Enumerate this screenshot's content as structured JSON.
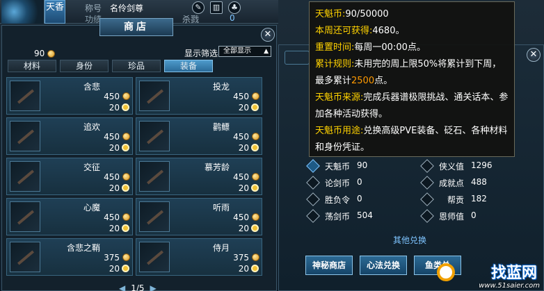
{
  "character": {
    "badge": "天香",
    "title_label": "称号",
    "title_value": "名伶剑尊",
    "kill_label": "杀戮",
    "kill_value": "0",
    "faded_label": "功绩"
  },
  "shop": {
    "title": "商店",
    "coins": "90",
    "filter_label": "显示筛选",
    "filter_value": "全部显示",
    "tabs": [
      {
        "label": "材料"
      },
      {
        "label": "身份"
      },
      {
        "label": "珍品"
      },
      {
        "label": "装备",
        "active": true
      }
    ],
    "items": [
      {
        "name": "含悲",
        "price": "450",
        "points": "20"
      },
      {
        "name": "投龙",
        "price": "450",
        "points": "20"
      },
      {
        "name": "追欢",
        "price": "450",
        "points": "20"
      },
      {
        "name": "鹳鳔",
        "price": "450",
        "points": "20"
      },
      {
        "name": "交征",
        "price": "450",
        "points": "20"
      },
      {
        "name": "慕芳龄",
        "price": "450",
        "points": "20"
      },
      {
        "name": "心魔",
        "price": "450",
        "points": "20"
      },
      {
        "name": "听雨",
        "price": "450",
        "points": "20"
      },
      {
        "name": "含悲之鞘",
        "price": "375",
        "points": "20"
      },
      {
        "name": "侍月",
        "price": "375",
        "points": "20"
      }
    ],
    "page": "1/5"
  },
  "stats": [
    {
      "label": "天魁币",
      "value": "90"
    },
    {
      "label": "侠义值",
      "value": "1296"
    },
    {
      "label": "论剑币",
      "value": "0"
    },
    {
      "label": "成就点",
      "value": "488"
    },
    {
      "label": "胜负令",
      "value": "0"
    },
    {
      "label": "帮贡",
      "value": "182"
    },
    {
      "label": "荡剑币",
      "value": "504"
    },
    {
      "label": "恩师值",
      "value": "0"
    }
  ],
  "other_exchange": "其他兑换",
  "buttons": [
    {
      "label": "神秘商店"
    },
    {
      "label": "心法兑换"
    },
    {
      "label": "鱼类兑"
    }
  ],
  "tooltip": {
    "line1_label": "天魁币:",
    "line1_value": "90/50000",
    "line2_label": "本周还可获得:",
    "line2_value": "4680。",
    "line3_label": "重置时间:",
    "line3_value": "每周一00:00点。",
    "line4_label": "累计规则:",
    "line4_value_a": "未用完的周上限50%将累计到下周，最多累计",
    "line4_highlight": "2500",
    "line4_value_b": "点。",
    "line5_label": "天魁币来源:",
    "line5_value": "完成兵器谱极限挑战、通关话本、参加各种活动获得。",
    "line6_label": "天魁币用途:",
    "line6_value": "兑换高级PVE装备、砭石、各种材料和身份凭证。"
  },
  "watermark": {
    "logo": "找蓝网",
    "url": "www.51saier.com"
  }
}
